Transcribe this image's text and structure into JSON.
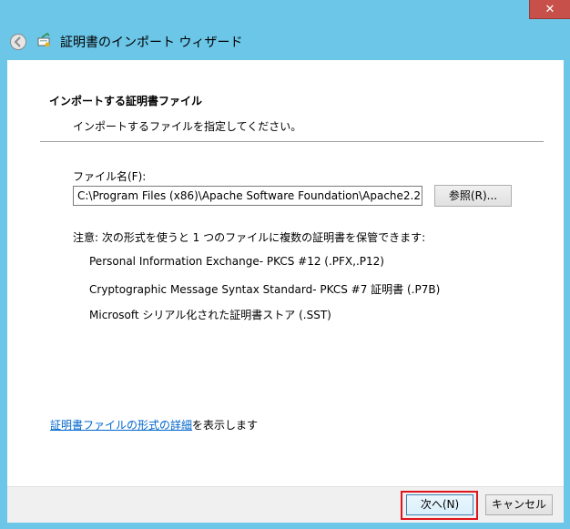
{
  "titlebar": {
    "close_glyph": "✕"
  },
  "header": {
    "title": "証明書のインポート ウィザード"
  },
  "page": {
    "section_title": "インポートする証明書ファイル",
    "section_desc": "インポートするファイルを指定してください。",
    "file_label": "ファイル名(F):",
    "file_value": "C:\\Program Files (x86)\\Apache Software Foundation\\Apache2.2",
    "browse_label": "参照(R)...",
    "note": "注意: 次の形式を使うと 1 つのファイルに複数の証明書を保管できます:",
    "formats": [
      "Personal Information Exchange- PKCS #12 (.PFX,.P12)",
      "Cryptographic Message Syntax Standard- PKCS #7 証明書 (.P7B)",
      "Microsoft シリアル化された証明書ストア (.SST)"
    ],
    "details_link": "証明書ファイルの形式の詳細",
    "details_suffix": "を表示します"
  },
  "footer": {
    "next_label": "次へ(N)",
    "cancel_label": "キャンセル"
  },
  "colors": {
    "frame": "#6bc6e8",
    "close": "#c7504a",
    "highlight": "#e0141b",
    "link": "#0066cc"
  },
  "icons": {
    "back": "back-arrow-icon",
    "wizard": "certificate-wizard-icon"
  }
}
